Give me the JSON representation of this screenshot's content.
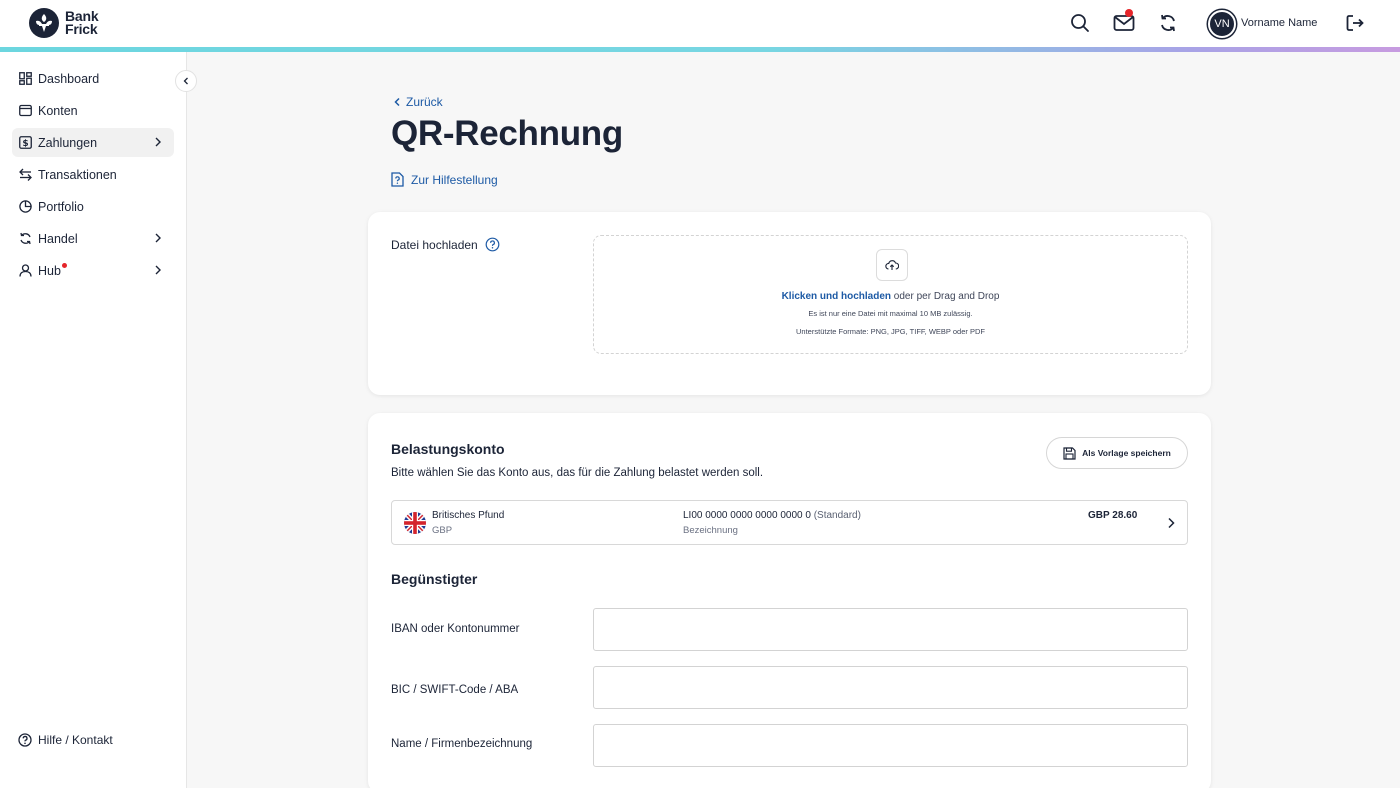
{
  "header": {
    "logo_line1": "Bank",
    "logo_line2": "Frick",
    "user_initials": "VN",
    "user_name": "Vorname Name",
    "icons": [
      "search-icon",
      "mail-icon",
      "refresh-icon",
      "logout-icon"
    ],
    "notification_color": "#e5252a"
  },
  "sidebar": {
    "items": [
      {
        "label": "Dashboard",
        "icon": "dashboard-icon"
      },
      {
        "label": "Konten",
        "icon": "wallet-icon"
      },
      {
        "label": "Zahlungen",
        "icon": "payment-icon",
        "active": true,
        "has_submenu": true
      },
      {
        "label": "Transaktionen",
        "icon": "transfer-icon"
      },
      {
        "label": "Portfolio",
        "icon": "pie-chart-icon"
      },
      {
        "label": "Handel",
        "icon": "trade-icon",
        "has_submenu": true
      },
      {
        "label": "Hub",
        "icon": "user-icon",
        "has_submenu": true,
        "has_badge": true
      }
    ],
    "help_label": "Hilfe / Kontakt"
  },
  "main": {
    "back_label": "Zurück",
    "title": "QR-Rechnung",
    "help_link": "Zur Hilfestellung",
    "upload": {
      "label": "Datei hochladen",
      "link_text": "Klicken und hochladen",
      "text_rest": " oder per Drag and Drop",
      "limit_text": "Es ist nur eine Datei mit maximal 10 MB zulässig.",
      "formats_text": "Unterstützte Formate: PNG, JPG, TIFF, WEBP oder PDF"
    },
    "debit_account": {
      "title": "Belastungskonto",
      "subtitle": "Bitte wählen Sie das Konto aus, das für die Zahlung belastet werden soll.",
      "save_template": "Als Vorlage speichern",
      "account": {
        "currency_name": "Britisches Pfund",
        "currency_code": "GBP",
        "iban": "LI00 0000 0000 0000 0000 0",
        "iban_tag": "(Standard)",
        "description": "Bezeichnung",
        "balance": "GBP 28.60"
      }
    },
    "beneficiary": {
      "title": "Begünstigter",
      "fields": [
        {
          "label": "IBAN oder Kontonummer",
          "value": ""
        },
        {
          "label": "BIC / SWIFT-Code / ABA",
          "value": ""
        },
        {
          "label": "Name / Firmenbezeichnung",
          "value": ""
        }
      ]
    }
  },
  "colors": {
    "brand_dark": "#1c2437",
    "link_blue": "#1d5aa5",
    "accent_gradient_start": "#6cd6df",
    "accent_gradient_end": "#c79be0"
  }
}
